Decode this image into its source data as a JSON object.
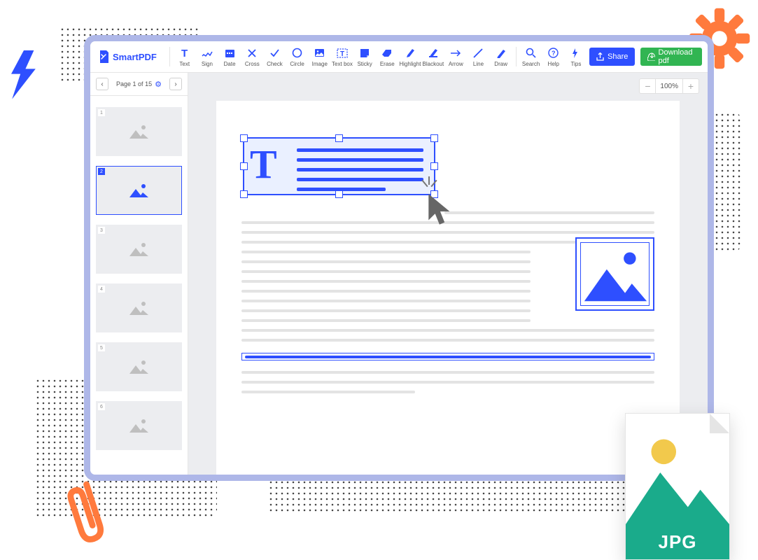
{
  "app": {
    "name": "SmartPDF"
  },
  "toolbar": {
    "tools": [
      {
        "label": "Text"
      },
      {
        "label": "Sign"
      },
      {
        "label": "Date"
      },
      {
        "label": "Cross"
      },
      {
        "label": "Check"
      },
      {
        "label": "Circle"
      },
      {
        "label": "Image"
      },
      {
        "label": "Text box"
      },
      {
        "label": "Sticky"
      },
      {
        "label": "Erase"
      },
      {
        "label": "Highlight"
      },
      {
        "label": "Blackout"
      },
      {
        "label": "Arrow"
      },
      {
        "label": "Line"
      },
      {
        "label": "Draw"
      }
    ],
    "right": [
      {
        "label": "Search"
      },
      {
        "label": "Help"
      },
      {
        "label": "Tips"
      }
    ],
    "share": "Share",
    "download": "Download pdf"
  },
  "pager": {
    "label": "Page 1 of 15"
  },
  "thumbs": [
    {
      "num": "1"
    },
    {
      "num": "2"
    },
    {
      "num": "3"
    },
    {
      "num": "4"
    },
    {
      "num": "5"
    },
    {
      "num": "6"
    }
  ],
  "zoom": {
    "level": "100%"
  },
  "jpg": {
    "label": "JPG"
  }
}
